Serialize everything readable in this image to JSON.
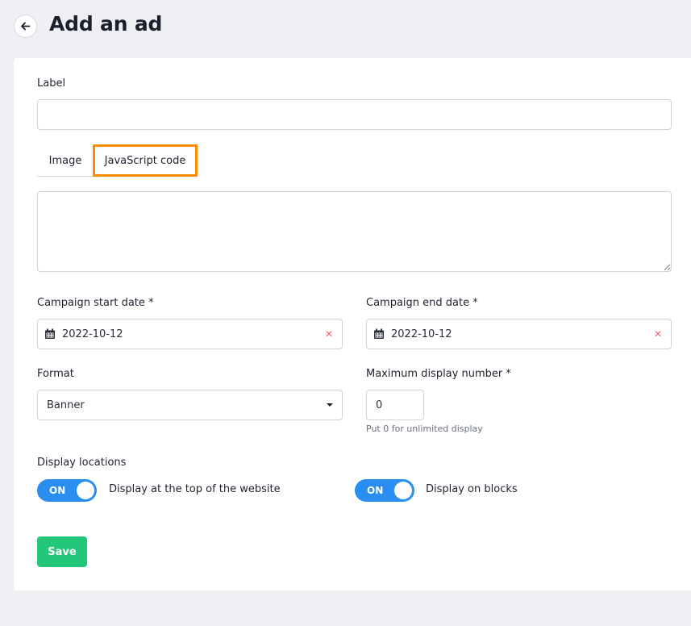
{
  "header": {
    "title": "Add an ad",
    "back_icon": "arrow-left-icon"
  },
  "form": {
    "label_field": {
      "label": "Label",
      "value": ""
    },
    "tabs": [
      {
        "label": "Image",
        "active": false
      },
      {
        "label": "JavaScript code",
        "active": true
      }
    ],
    "code_field": {
      "value": ""
    },
    "start_date": {
      "label": "Campaign start date *",
      "value": "2022-10-12",
      "icon": "calendar-icon",
      "clear_icon": "clear-x-icon"
    },
    "end_date": {
      "label": "Campaign end date *",
      "value": "2022-10-12",
      "icon": "calendar-icon",
      "clear_icon": "clear-x-icon"
    },
    "format": {
      "label": "Format",
      "selected": "Banner"
    },
    "max_display": {
      "label": "Maximum display number *",
      "value": "0",
      "hint": "Put 0 for unlimited display"
    },
    "display_locations": {
      "label": "Display locations",
      "toggles": [
        {
          "state": "ON",
          "label": "Display at the top of the website"
        },
        {
          "state": "ON",
          "label": "Display on blocks"
        }
      ]
    },
    "save_label": "Save"
  },
  "colors": {
    "accent_orange": "#fb8c00",
    "toggle_blue": "#2a8ef0",
    "save_green": "#23c77a",
    "clear_red": "#f06272"
  }
}
